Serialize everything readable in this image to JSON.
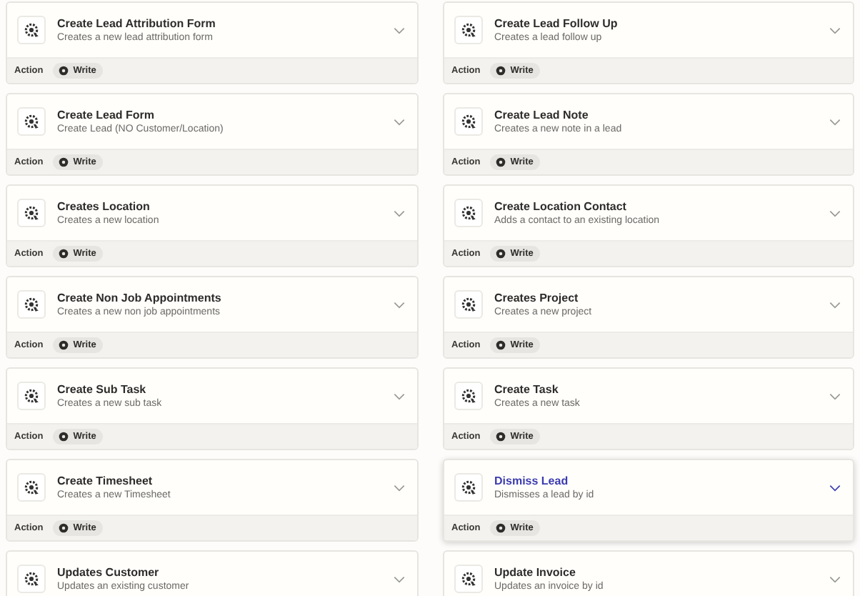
{
  "cards": [
    {
      "title": "Create Lead Attribution Form",
      "description": "Creates a new lead attribution form",
      "selected": false,
      "action_label": "Action",
      "badge": "Write"
    },
    {
      "title": "Create Lead Follow Up",
      "description": "Creates a lead follow up",
      "selected": false,
      "action_label": "Action",
      "badge": "Write"
    },
    {
      "title": "Create Lead Form",
      "description": "Create Lead (NO Customer/Location)",
      "selected": false,
      "action_label": "Action",
      "badge": "Write"
    },
    {
      "title": "Create Lead Note",
      "description": "Creates a new note in a lead",
      "selected": false,
      "action_label": "Action",
      "badge": "Write"
    },
    {
      "title": "Creates Location",
      "description": "Creates a new location",
      "selected": false,
      "action_label": "Action",
      "badge": "Write"
    },
    {
      "title": "Create Location Contact",
      "description": "Adds a contact to an existing location",
      "selected": false,
      "action_label": "Action",
      "badge": "Write"
    },
    {
      "title": "Create Non Job Appointments",
      "description": "Creates a new non job appointments",
      "selected": false,
      "action_label": "Action",
      "badge": "Write"
    },
    {
      "title": "Creates Project",
      "description": "Creates a new project",
      "selected": false,
      "action_label": "Action",
      "badge": "Write"
    },
    {
      "title": "Create Sub Task",
      "description": "Creates a new sub task",
      "selected": false,
      "action_label": "Action",
      "badge": "Write"
    },
    {
      "title": "Create Task",
      "description": "Creates a new task",
      "selected": false,
      "action_label": "Action",
      "badge": "Write"
    },
    {
      "title": "Create Timesheet",
      "description": "Creates a new Timesheet",
      "selected": false,
      "action_label": "Action",
      "badge": "Write"
    },
    {
      "title": "Dismiss Lead",
      "description": "Dismisses a lead by id",
      "selected": true,
      "action_label": "Action",
      "badge": "Write"
    },
    {
      "title": "Updates Customer",
      "description": "Updates an existing customer",
      "selected": false
    },
    {
      "title": "Update Invoice",
      "description": "Updates an invoice by id",
      "selected": false
    }
  ]
}
